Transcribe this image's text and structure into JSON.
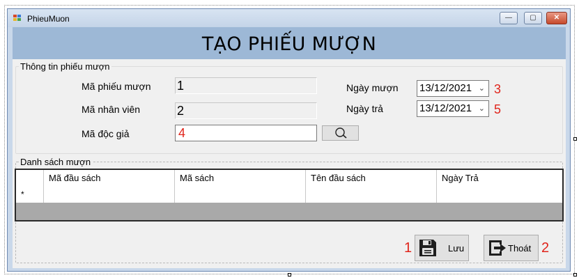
{
  "window": {
    "title": "PhieuMuon",
    "minimize_label": "—",
    "maximize_label": "▢",
    "close_label": "✕"
  },
  "header": {
    "title": "TẠO PHIẾU MƯỢN"
  },
  "info_group": {
    "title": "Thông tin phiếu mượn",
    "ma_phieu_muon": {
      "label": "Mã phiếu mượn",
      "value": "",
      "marker": "1"
    },
    "ma_nhan_vien": {
      "label": "Mã nhân viên",
      "value": "",
      "marker": "2"
    },
    "ma_doc_gia": {
      "label": "Mã độc giả",
      "value": "",
      "marker": "4"
    },
    "ngay_muon": {
      "label": "Ngày mượn",
      "value": "13/12/2021",
      "marker": "3"
    },
    "ngay_tra": {
      "label": "Ngày trả",
      "value": "13/12/2021",
      "marker": "5"
    },
    "search_icon": "search-icon"
  },
  "list_group": {
    "title": "Danh sách mượn",
    "columns": [
      "Mã đầu sách",
      "Mã sách",
      "Tên đầu sách",
      "Ngày Trả"
    ],
    "new_row_marker": "*"
  },
  "actions": {
    "save": {
      "label": "Lưu",
      "marker": "1",
      "icon": "save-disk-icon"
    },
    "exit": {
      "label": "Thoát",
      "marker": "2",
      "icon": "exit-arrow-icon"
    }
  },
  "colors": {
    "header": "#9db8d6",
    "marker": "#e0241b",
    "window_frame": "#c9d8ea"
  }
}
